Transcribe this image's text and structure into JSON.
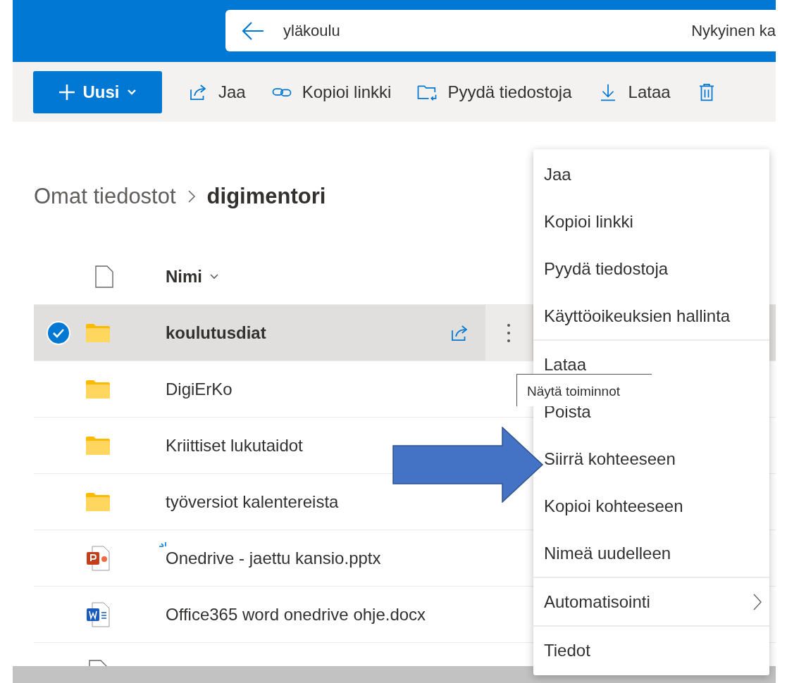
{
  "search": {
    "value": "yläkoulu",
    "scope": "Nykyinen ka"
  },
  "toolbar": {
    "new_button": "Uusi",
    "items": [
      {
        "label": "Jaa",
        "kind": "share"
      },
      {
        "label": "Kopioi linkki",
        "kind": "link"
      },
      {
        "label": "Pyydä tiedostoja",
        "kind": "request"
      },
      {
        "label": "Lataa",
        "kind": "download"
      },
      {
        "kind": "delete"
      }
    ]
  },
  "breadcrumb": [
    {
      "label": "Omat tiedostot",
      "current": false
    },
    {
      "label": "digimentori",
      "current": true
    }
  ],
  "table": {
    "name_column": "Nimi",
    "rows": [
      {
        "name": "koulutusdiat",
        "kind": "folder",
        "selected": true,
        "is_new": false
      },
      {
        "name": "DigiErKo",
        "kind": "folder",
        "selected": false,
        "is_new": false
      },
      {
        "name": "Kriittiset lukutaidot",
        "kind": "folder",
        "selected": false,
        "is_new": false
      },
      {
        "name": "työversiot kalentereista",
        "kind": "folder",
        "selected": false,
        "is_new": false
      },
      {
        "name": "Onedrive - jaettu kansio.pptx",
        "kind": "pptx",
        "selected": false,
        "is_new": true
      },
      {
        "name": "Office365 word onedrive ohje.docx",
        "kind": "docx",
        "selected": false,
        "is_new": false
      },
      {
        "kind": "file",
        "selected": false,
        "is_new": false
      }
    ]
  },
  "context_menu": {
    "groups": [
      [
        {
          "label": "Jaa",
          "has_submenu": false
        },
        {
          "label": "Kopioi linkki",
          "has_submenu": false
        },
        {
          "label": "Pyydä tiedostoja",
          "has_submenu": false
        },
        {
          "label": "Käyttöoikeuksien hallinta",
          "has_submenu": false
        }
      ],
      [
        {
          "label": "Lataa",
          "has_submenu": false
        },
        {
          "label": "Poista",
          "has_submenu": false
        },
        {
          "label": "Siirrä kohteeseen",
          "has_submenu": false
        },
        {
          "label": "Kopioi kohteeseen",
          "has_submenu": false
        },
        {
          "label": "Nimeä uudelleen",
          "has_submenu": false
        }
      ],
      [
        {
          "label": "Automatisointi",
          "has_submenu": true
        }
      ],
      [
        {
          "label": "Tiedot",
          "has_submenu": false
        }
      ]
    ]
  },
  "tooltip": "Näytä toiminnot"
}
